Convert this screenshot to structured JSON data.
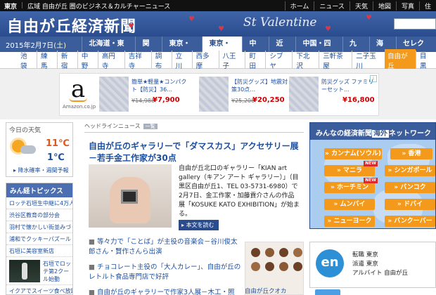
{
  "topbar": {
    "tag": "東京",
    "separator": "|",
    "description": "広域 自由が丘 圏のビジネス＆カルチャーニュース",
    "links": [
      "ホーム",
      "ニュース",
      "天気",
      "地図",
      "写真",
      "住"
    ]
  },
  "header": {
    "logo": "自由が丘経済新聞",
    "banner_text": "St Valentine",
    "heart_glyph": "♥"
  },
  "date": {
    "text": "2015年2月7日",
    "weekday": "(土)"
  },
  "regions": {
    "items": [
      "北海道・東北",
      "関東",
      "東京・東",
      "東京・西",
      "中部",
      "近畿",
      "中国・四国",
      "九州",
      "海外",
      "セレクト"
    ],
    "active": 3
  },
  "cities": {
    "items": [
      "池袋",
      "練馬",
      "新宿",
      "中野",
      "高円寺",
      "吉祥寺",
      "調布",
      "立川",
      "西多摩",
      "八王子",
      "町田",
      "シブヤ",
      "下北沢",
      "三軒茶屋",
      "二子玉川",
      "自由が丘",
      "目黒"
    ],
    "active": 15
  },
  "ad": {
    "brand": "a",
    "brand_caption": "Amazon.co.jp",
    "adchoices": "i",
    "products": [
      {
        "name": "簡単★軽量★コンパクト【防災】36…",
        "old_price": "¥14,980",
        "new_price": "¥7,900"
      },
      {
        "name": "【防災グッズ】地震対策30点…",
        "old_price": "¥25,200",
        "new_price": "¥20,250"
      },
      {
        "name": "防災グッズ ファミリーセット…",
        "old_price": "",
        "new_price": "¥16,800"
      }
    ]
  },
  "weather": {
    "title": "今日の天気",
    "high": "11℃",
    "low": "1℃",
    "rain_link": "▸ 降水確率・週間予報"
  },
  "topics": {
    "title": "みん経トピックス",
    "items": [
      "ロッテ石垣生中継に4万人",
      "渋谷区教育の部分会",
      "羽村で懐かしい街並みづくり",
      "浦和でクッキーパズール",
      "石垣に美容室新店"
    ],
    "photo_caption": "石垣でロッテ第2クール始動",
    "last_item": "イクアでスイーツ食べ放題"
  },
  "main": {
    "tab_label": "ヘッドラインニュース",
    "tab_more": "一覧",
    "headline": "自由が丘のギャラリーで「ダマスカス」アクセサリー展－若手金工作家が30点",
    "lead": "自由が丘北口のギャラリー「KIAN art gallery（キアン アート ギャラリー）」（目黒区自由が丘1、TEL 03-5731-6980）で2月7日、金工作家・加藤貢介さんの作品展「KOSUKE KATO EXHIBITION」が始まる。",
    "readmore": "本文を読む",
    "bullet": "■",
    "news": [
      "等々力で「ことば」が主役の音楽会－谷川俊太郎さん・賢作さんら出演",
      "チョコレート主役の「大人カレー」、自由が丘のレトルト食品専門店で好評",
      "自由が丘のギャラリーで作家3人展－木工・照"
    ],
    "side_caption": "自由が丘クオカ"
  },
  "network": {
    "title_prefix": "みんなの経済新聞",
    "title_overseas": "海外",
    "title_suffix": "ネットワーク",
    "new_badge": "NEW",
    "cities": [
      "カンナム(ソウル)",
      "香港",
      "マニラ",
      "シンガポール",
      "ホーチミン",
      "バンコク",
      "ムンバイ",
      "ドバイ",
      "ニューヨーク",
      "バンクーバー"
    ]
  },
  "en": {
    "logo": "en",
    "lines": [
      "転職 東京",
      "派遣 東京",
      "アルバイト 自由が丘"
    ]
  }
}
